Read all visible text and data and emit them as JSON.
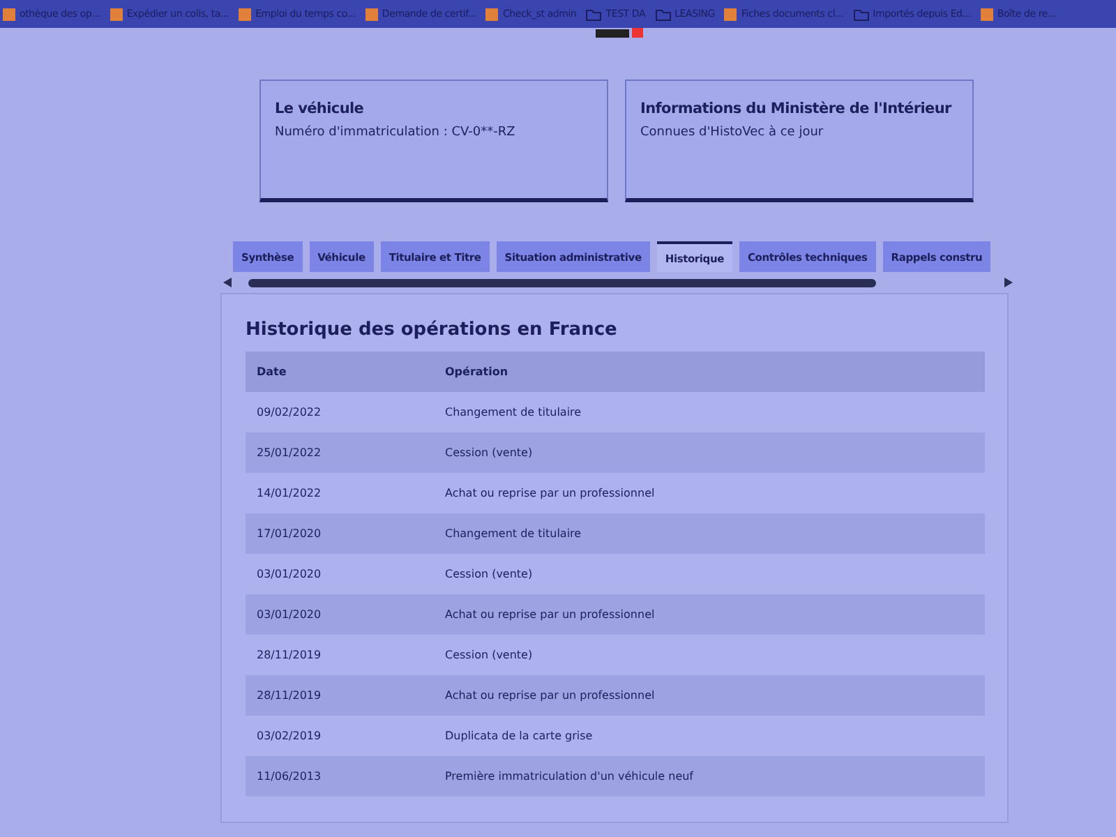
{
  "bookmarks": [
    {
      "label": "othèque des op...",
      "kind": "page"
    },
    {
      "label": "Expédier un colis, ta...",
      "kind": "page"
    },
    {
      "label": "Emploi du temps co...",
      "kind": "page"
    },
    {
      "label": "Demande de certif...",
      "kind": "page"
    },
    {
      "label": "Check_st admin",
      "kind": "page"
    },
    {
      "label": "TEST DA",
      "kind": "folder"
    },
    {
      "label": "LEASING",
      "kind": "folder"
    },
    {
      "label": "Fiches documents cl...",
      "kind": "page"
    },
    {
      "label": "Importés depuis Ed...",
      "kind": "folder"
    },
    {
      "label": "Boîte de re...",
      "kind": "page"
    }
  ],
  "cards": [
    {
      "title": "Le véhicule",
      "text": "Numéro d'immatriculation : CV-0**-RZ"
    },
    {
      "title": "Informations du Ministère de l'Intérieur",
      "text": "Connues d'HistoVec à ce jour"
    }
  ],
  "tabs": [
    {
      "label": "Synthèse",
      "selected": false
    },
    {
      "label": "Véhicule",
      "selected": false
    },
    {
      "label": "Titulaire et Titre",
      "selected": false
    },
    {
      "label": "Situation administrative",
      "selected": false
    },
    {
      "label": "Historique",
      "selected": true
    },
    {
      "label": "Contrôles techniques",
      "selected": false
    },
    {
      "label": "Rappels constru",
      "selected": false
    }
  ],
  "history": {
    "title": "Historique des opérations en France",
    "columns": [
      "Date",
      "Opération"
    ],
    "rows": [
      [
        "09/02/2022",
        "Changement de titulaire"
      ],
      [
        "25/01/2022",
        "Cession (vente)"
      ],
      [
        "14/01/2022",
        "Achat ou reprise par un professionnel"
      ],
      [
        "17/01/2020",
        "Changement de titulaire"
      ],
      [
        "03/01/2020",
        "Cession (vente)"
      ],
      [
        "03/01/2020",
        "Achat ou reprise par un professionnel"
      ],
      [
        "28/11/2019",
        "Cession (vente)"
      ],
      [
        "28/11/2019",
        "Achat ou reprise par un professionnel"
      ],
      [
        "03/02/2019",
        "Duplicata de la carte grise"
      ],
      [
        "11/06/2013",
        "Première immatriculation d'un véhicule neuf"
      ]
    ]
  }
}
